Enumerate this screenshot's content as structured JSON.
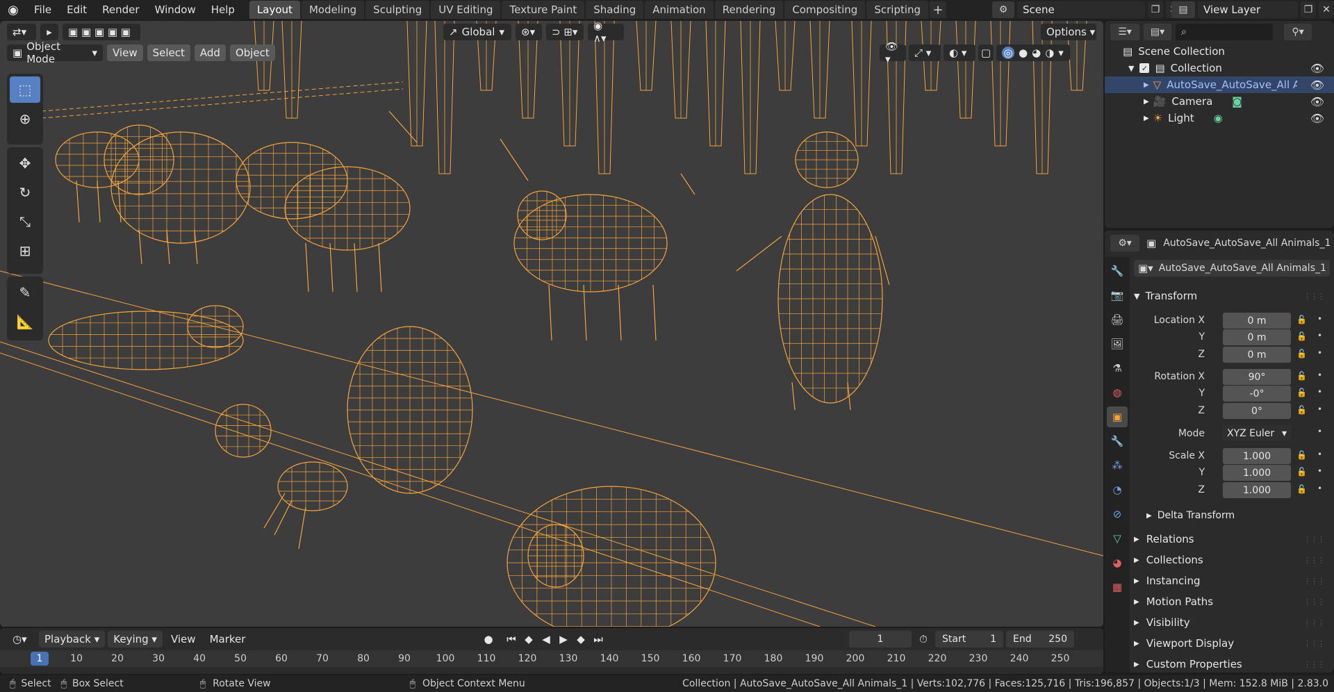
{
  "menubar": {
    "menus": [
      "File",
      "Edit",
      "Render",
      "Window",
      "Help"
    ],
    "workspaces": [
      "Layout",
      "Modeling",
      "Sculpting",
      "UV Editing",
      "Texture Paint",
      "Shading",
      "Animation",
      "Rendering",
      "Compositing",
      "Scripting"
    ],
    "active_workspace": "Layout",
    "add_tab": "+",
    "scene": "Scene",
    "view_layer": "View Layer"
  },
  "viewport": {
    "orientation": "Global",
    "options": "Options",
    "mode": "Object Mode",
    "menus": [
      "View",
      "Select",
      "Add",
      "Object"
    ],
    "wire_color": "#f5a43c",
    "bg_color": "#3d3d3d"
  },
  "outliner": {
    "scene_collection": "Scene Collection",
    "rows": [
      {
        "label": "Collection",
        "icon": "collection-icon"
      },
      {
        "label": "AutoSave_AutoSave_All Anima",
        "icon": "mesh-icon"
      },
      {
        "label": "Camera",
        "icon": "camera-icon"
      },
      {
        "label": "Light",
        "icon": "light-icon"
      }
    ]
  },
  "properties": {
    "header_name": "AutoSave_AutoSave_All Animals_1",
    "object_name": "AutoSave_AutoSave_All Animals_1",
    "transform_title": "Transform",
    "location": {
      "label_x": "Location X",
      "label_y": "Y",
      "label_z": "Z",
      "x": "0 m",
      "y": "0 m",
      "z": "0 m"
    },
    "rotation": {
      "label_x": "Rotation X",
      "label_y": "Y",
      "label_z": "Z",
      "x": "90°",
      "y": "-0°",
      "z": "0°"
    },
    "mode": {
      "label": "Mode",
      "value": "XYZ Euler"
    },
    "scale": {
      "label_x": "Scale X",
      "label_y": "Y",
      "label_z": "Z",
      "x": "1.000",
      "y": "1.000",
      "z": "1.000"
    },
    "delta_transform": "Delta Transform",
    "panels": [
      "Relations",
      "Collections",
      "Instancing",
      "Motion Paths",
      "Visibility",
      "Viewport Display",
      "Custom Properties"
    ]
  },
  "timeline": {
    "menus": [
      "Playback",
      "Keying",
      "View",
      "Marker"
    ],
    "current_frame": "1",
    "start_label": "Start",
    "start": "1",
    "end_label": "End",
    "end": "250",
    "ruler": [
      "1",
      "10",
      "20",
      "30",
      "40",
      "50",
      "60",
      "70",
      "80",
      "90",
      "100",
      "110",
      "120",
      "130",
      "140",
      "150",
      "160",
      "170",
      "180",
      "190",
      "200",
      "210",
      "220",
      "230",
      "240",
      "250"
    ]
  },
  "status": {
    "select": "Select",
    "box_select": "Box Select",
    "rotate_view": "Rotate View",
    "context_menu": "Object Context Menu",
    "stats": "Collection | AutoSave_AutoSave_All Animals_1 | Verts:102,776 | Faces:125,716 | Tris:196,857 | Objects:1/3 | Mem: 152.8 MiB | 2.83.0"
  }
}
